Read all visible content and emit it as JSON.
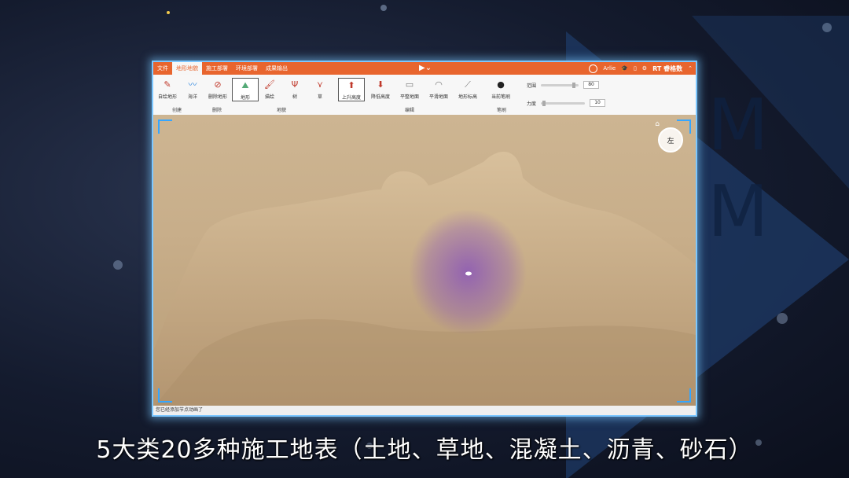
{
  "app": {
    "menu_tabs": [
      "文件",
      "地形地貌",
      "施工部署",
      "环境部署",
      "成果输出"
    ],
    "active_tab_index": 1,
    "user": "Arlie",
    "brand": "RT 睿格数",
    "accent_color": "#e8652e"
  },
  "ribbon": {
    "tools": [
      {
        "label": "自绘地形",
        "icon": "pen-icon"
      },
      {
        "label": "海洋",
        "icon": "water-icon"
      },
      {
        "label": "删除地形",
        "icon": "delete-icon"
      },
      {
        "label": "地形",
        "icon": "terrain-icon"
      },
      {
        "label": "描绘",
        "icon": "brush-icon"
      },
      {
        "label": "树",
        "icon": "tree-icon"
      },
      {
        "label": "草",
        "icon": "grass-icon"
      },
      {
        "label": "上升高度",
        "icon": "up-arrow-icon"
      },
      {
        "label": "降低高度",
        "icon": "down-arrow-icon"
      },
      {
        "label": "平整地面",
        "icon": "flatten-icon"
      },
      {
        "label": "平滑地面",
        "icon": "smooth-icon"
      },
      {
        "label": "地形标高",
        "icon": "elevation-icon"
      },
      {
        "label": "当前笔刷",
        "icon": "brush-dot-icon"
      }
    ],
    "groups": {
      "create": "创建",
      "delete": "删除",
      "terrain": "地貌",
      "edit": "编辑",
      "brush": "笔刷"
    },
    "range_label": "范围",
    "range_value": "80",
    "force_label": "力度",
    "force_value": "10"
  },
  "viewport": {
    "cube_label": "左",
    "brush_color": "#8a56b8",
    "terrain_color": "#c9ae8a"
  },
  "status": "您已经添加节点动画了",
  "subtitle": "5大类20多种施工地表（土地、草地、混凝土、沥青、砂石）"
}
